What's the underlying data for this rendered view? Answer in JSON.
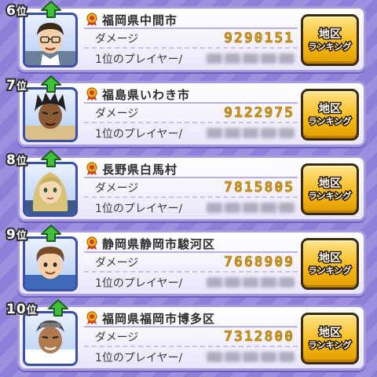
{
  "colors": {
    "background": "#8f7fd8",
    "card": "#ffffff",
    "damage_value": "#d69a10",
    "button": "#f5b915",
    "rank_up_arrow": "#3fbf3a"
  },
  "rows": [
    {
      "rank": "6",
      "rank_unit": "位",
      "trend_icon": "rank-up-arrow-icon",
      "region": "福岡県中間市",
      "damage_label": "ダメージ",
      "damage": "9290151",
      "top_player_label": "1位のプレイヤー/",
      "button_line1": "地区",
      "button_line2": "ランキング"
    },
    {
      "rank": "7",
      "rank_unit": "位",
      "trend_icon": "rank-up-arrow-icon",
      "region": "福島県いわき市",
      "damage_label": "ダメージ",
      "damage": "9122975",
      "top_player_label": "1位のプレイヤー/",
      "button_line1": "地区",
      "button_line2": "ランキング"
    },
    {
      "rank": "8",
      "rank_unit": "位",
      "trend_icon": "rank-up-arrow-icon",
      "region": "長野県白馬村",
      "damage_label": "ダメージ",
      "damage": "7815805",
      "top_player_label": "1位のプレイヤー/",
      "button_line1": "地区",
      "button_line2": "ランキング"
    },
    {
      "rank": "9",
      "rank_unit": "位",
      "trend_icon": "rank-up-arrow-icon",
      "region": "静岡県静岡市駿河区",
      "damage_label": "ダメージ",
      "damage": "7668909",
      "top_player_label": "1位のプレイヤー/",
      "button_line1": "地区",
      "button_line2": "ランキング"
    },
    {
      "rank": "10",
      "rank_unit": "位",
      "trend_icon": "rank-up-arrow-icon",
      "region": "福岡県福岡市博多区",
      "damage_label": "ダメージ",
      "damage": "7312800",
      "top_player_label": "1位のプレイヤー/",
      "button_line1": "地区",
      "button_line2": "ランキング"
    }
  ]
}
